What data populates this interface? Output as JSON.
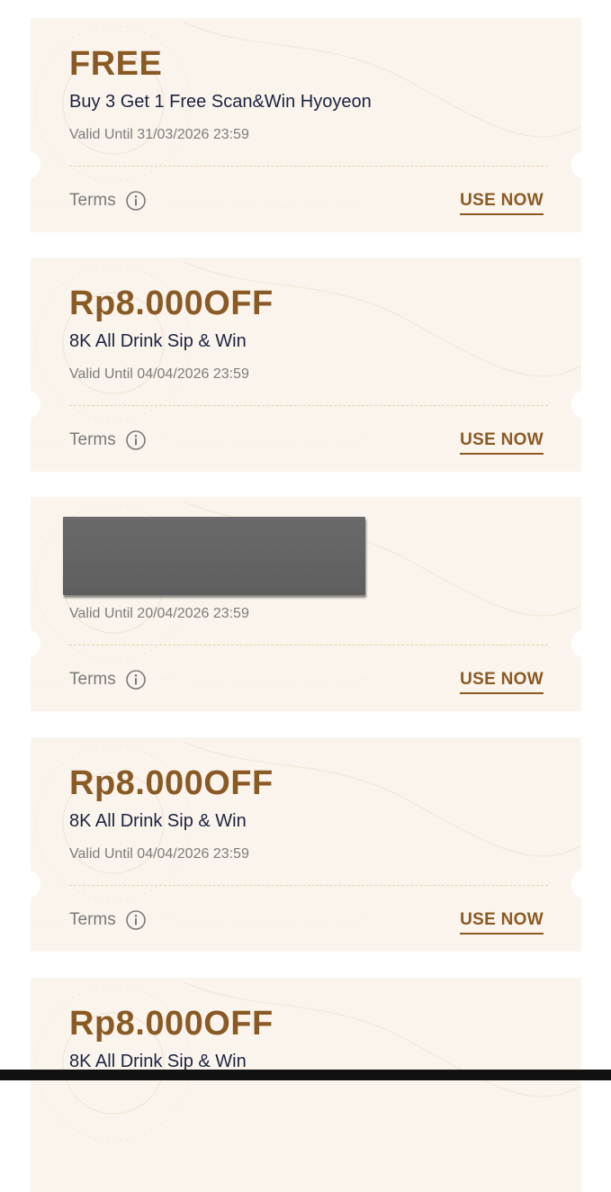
{
  "coupons": [
    {
      "title": "FREE",
      "description": "Buy 3 Get 1 Free Scan&Win Hyoyeon",
      "valid_until": "Valid Until 31/03/2026 23:59",
      "terms_label": "Terms",
      "action_label": "USE NOW",
      "redacted": false
    },
    {
      "title": "Rp8.000OFF",
      "description": "8K All Drink Sip & Win",
      "valid_until": "Valid Until 04/04/2026 23:59",
      "terms_label": "Terms",
      "action_label": "USE NOW",
      "redacted": false
    },
    {
      "title": "",
      "description": "",
      "valid_until": "Valid Until 20/04/2026 23:59",
      "terms_label": "Terms",
      "action_label": "USE NOW",
      "redacted": true
    },
    {
      "title": "Rp8.000OFF",
      "description": "8K All Drink Sip & Win",
      "valid_until": "Valid Until 04/04/2026 23:59",
      "terms_label": "Terms",
      "action_label": "USE NOW",
      "redacted": false
    },
    {
      "title": "Rp8.000OFF",
      "description": "8K All Drink Sip & Win",
      "valid_until": "",
      "terms_label": "",
      "action_label": "",
      "redacted": false
    }
  ],
  "icons": {
    "terms": "info-circle-icon"
  },
  "colors": {
    "accent": "#8a5a25",
    "card_background": "#fbf4ec",
    "description_text": "#1b2340",
    "muted_text": "#7a7a7a",
    "divider": "#e6d3ad"
  }
}
